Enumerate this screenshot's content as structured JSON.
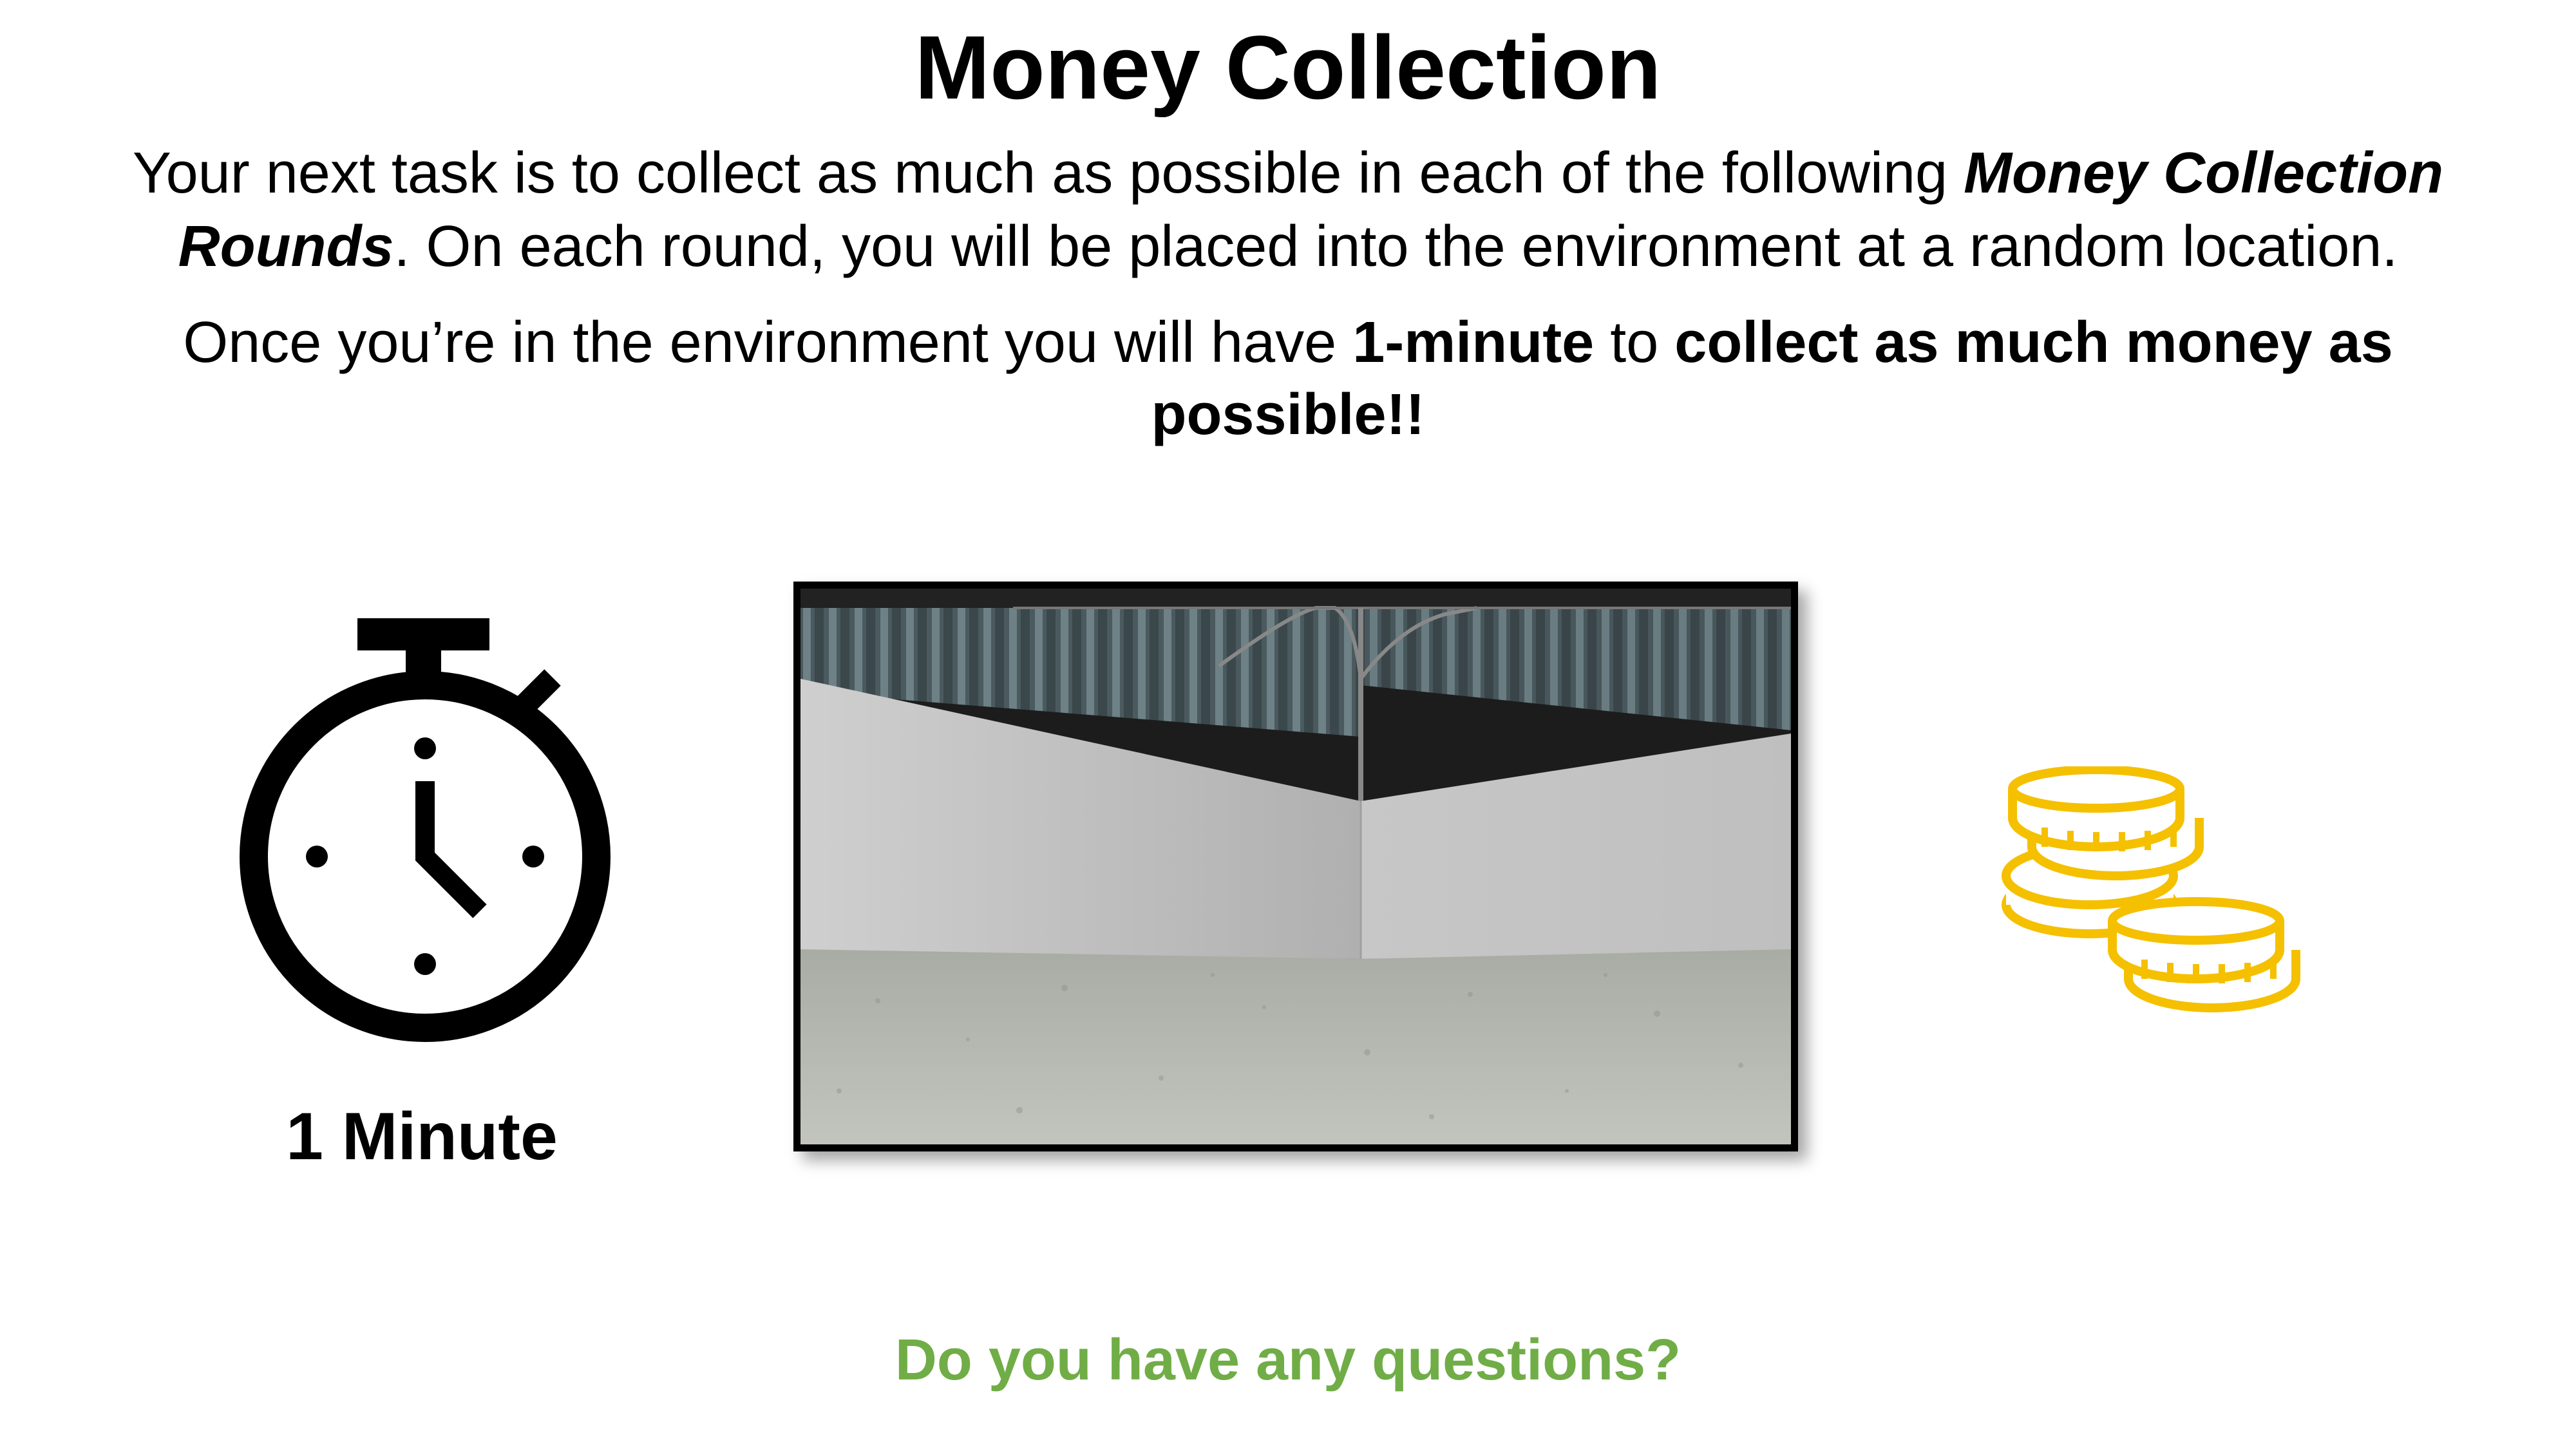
{
  "slide": {
    "title": "Money Collection",
    "para1": {
      "before": "Your next task is to collect as much as possible in each of the following ",
      "emphasis": "Money Collection Rounds",
      "after": ". On each round, you will be placed into the environment at a random location."
    },
    "para2": {
      "before": "Once you’re in the environment you will have ",
      "duration": "1-minute",
      "middle": " to ",
      "goal": "collect as much money as possible!!"
    },
    "timer_label": "1 Minute",
    "question": "Do you have any questions?",
    "icons": {
      "timer": "stopwatch-icon",
      "money": "coin-stack-icon"
    },
    "colors": {
      "accent_green": "#70ad47",
      "coin_gold": "#f5c000",
      "text": "#000000"
    }
  }
}
